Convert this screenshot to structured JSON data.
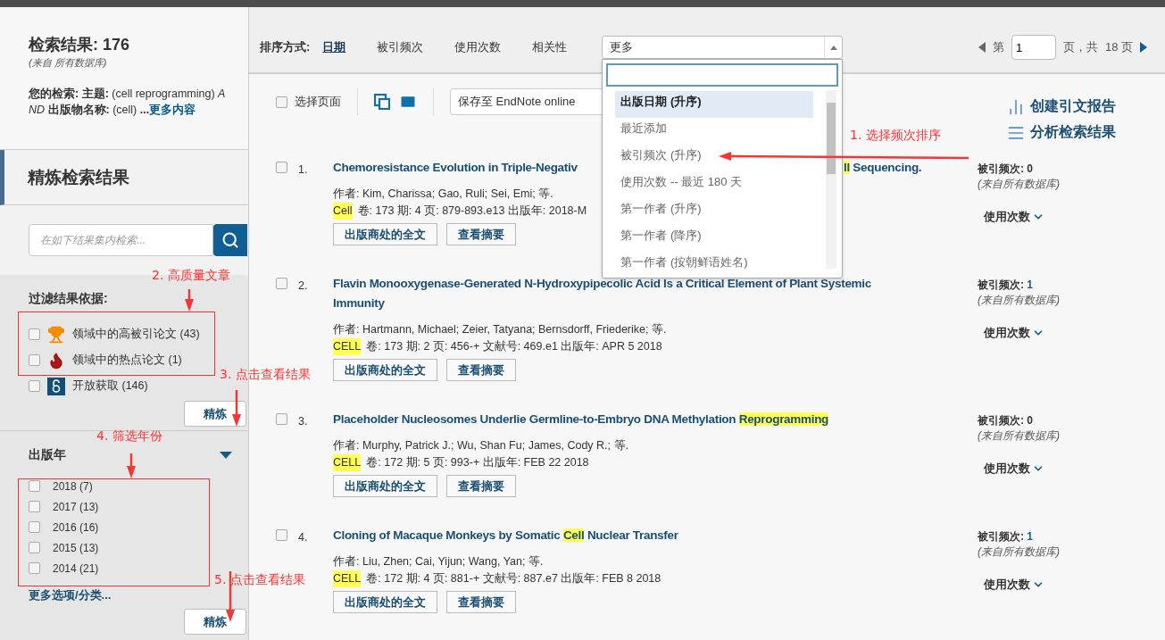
{
  "sidebar": {
    "results_title": "检索结果: 176",
    "results_source": "(来自 所有数据库)",
    "query": "**您的检索: 主题:** (cell reprogramming) *AND* **出版物名称:** (cell) **...**",
    "query_more": "更多内容",
    "refine_title": "精炼检索结果",
    "search": {
      "placeholder": "在如下结果集内检索..."
    },
    "filter_title": "过滤结果依据:",
    "filters": [
      {
        "label": "领域中的高被引论文 (43)",
        "checked": false,
        "kind": "trophy"
      },
      {
        "label": "领域中的热点论文 (1)",
        "checked": false,
        "kind": "hot"
      },
      {
        "label": "开放获取 (146)",
        "checked": false,
        "kind": "open"
      }
    ],
    "refine_button": "精炼",
    "year_title": "出版年",
    "year_expanded": true,
    "years": [
      {
        "label": "2018 (7)",
        "checked": false
      },
      {
        "label": "2017 (13)",
        "checked": false
      },
      {
        "label": "2016 (16)",
        "checked": false
      },
      {
        "label": "2015 (13)",
        "checked": false
      },
      {
        "label": "2014 (21)",
        "checked": false
      }
    ],
    "more_options": "更多选项/分类...",
    "refine_button_2": "精炼"
  },
  "sort_bar": {
    "label": "排序方式:",
    "options": [
      {
        "label": "日期",
        "selected": true
      },
      {
        "label": "被引频次",
        "selected": false
      },
      {
        "label": "使用次数",
        "selected": false
      },
      {
        "label": "相关性",
        "selected": false
      }
    ],
    "more_select": {
      "value": "更多",
      "expanded": true,
      "options": [
        {
          "label": "出版日期 (升序)",
          "selected": true
        },
        {
          "label": "最近添加",
          "selected": false
        },
        {
          "label": "被引频次 (升序)",
          "selected": false
        },
        {
          "label": "使用次数 -- 最近 180 天",
          "selected": false
        },
        {
          "label": "第一作者 (升序)",
          "selected": false
        },
        {
          "label": "第一作者 (降序)",
          "selected": false
        },
        {
          "label": "第一作者 (按朝鲜语姓名)",
          "selected": false
        }
      ]
    }
  },
  "pagination": {
    "prefix": "第",
    "page": "1",
    "middle": "页，共",
    "total": "18 页"
  },
  "toolbar": {
    "select_page": {
      "label": "选择页面",
      "checked": false
    },
    "save_select": "保存至 EndNote online",
    "links": [
      {
        "label": "创建引文报告",
        "kind": "chart"
      },
      {
        "label": "分析检索结果",
        "kind": "list"
      }
    ]
  },
  "records": [
    {
      "number": "1.",
      "checked": false,
      "title": [
        [
          {
            "text": "Chemoresistance Evolution in Triple-Negativ",
            "highlight": false
          }
        ],
        [
          {
            "text": "ll",
            "highlight": true
          },
          {
            "text": " Sequencing.",
            "highlight": false
          }
        ]
      ],
      "authors": "作者: Kim, Charissa; Gao, Ruli; Sei, Emi; 等.",
      "journal": "Cell",
      "meta": "卷: 173  期: 4  页: 879-893.e13  出版年: 2018-M",
      "buttons": [
        "出版商处的全文",
        "查看摘要"
      ],
      "citations_label": "被引频次:",
      "citations": "0",
      "cited_link": false,
      "citations_source": "(来自所有数据库)",
      "usage": "使用次数"
    },
    {
      "number": "2.",
      "checked": false,
      "title": [
        [
          {
            "text": "Flavin Monooxygenase-Generated N-Hydroxypipecolic Acid Is a Critical Element of Plant Systemic Immunity",
            "highlight": false
          }
        ]
      ],
      "authors": "作者: Hartmann, Michael; Zeier, Tatyana; Bernsdorff, Friederike; 等.",
      "journal": "CELL",
      "meta": "卷: 173  期: 2  页: 456-+  文献号: 469.e1  出版年: APR 5 2018",
      "buttons": [
        "出版商处的全文",
        "查看摘要"
      ],
      "citations_label": "被引频次:",
      "citations": "1",
      "cited_link": true,
      "citations_source": "(来自所有数据库)",
      "usage": "使用次数"
    },
    {
      "number": "3.",
      "checked": false,
      "title": [
        [
          {
            "text": "Placeholder Nucleosomes Underlie Germline-to-Embryo DNA Methylation ",
            "highlight": false
          },
          {
            "text": "Reprogramming",
            "highlight": true
          }
        ]
      ],
      "authors": "作者: Murphy, Patrick J.; Wu, Shan Fu; James, Cody R.; 等.",
      "journal": "CELL",
      "meta": "卷: 172  期: 5  页: 993-+  出版年: FEB 22 2018",
      "buttons": [
        "出版商处的全文",
        "查看摘要"
      ],
      "citations_label": "被引频次:",
      "citations": "0",
      "cited_link": false,
      "citations_source": "(来自所有数据库)",
      "usage": "使用次数"
    },
    {
      "number": "4.",
      "checked": false,
      "title": [
        [
          {
            "text": "Cloning of Macaque Monkeys by Somatic ",
            "highlight": false
          },
          {
            "text": "Cell",
            "highlight": true
          },
          {
            "text": " Nuclear Transfer",
            "highlight": false
          }
        ]
      ],
      "authors": "作者: Liu, Zhen; Cai, Yijun; Wang, Yan; 等.",
      "journal": "CELL",
      "meta": "卷: 172  期: 4  页: 881-+  文献号: 887.e7  出版年: FEB 8 2018",
      "buttons": [
        "出版商处的全文",
        "查看摘要"
      ],
      "citations_label": "被引频次:",
      "citations": "1",
      "cited_link": true,
      "citations_source": "(来自所有数据库)",
      "usage": "使用次数"
    }
  ],
  "annotations": [
    {
      "text": "1.  选择频次排序"
    },
    {
      "text": "2.  高质量文章"
    },
    {
      "text": "3.  点击查看结果"
    },
    {
      "text": "4.  筛选年份"
    },
    {
      "text": "5.  点击查看结果"
    }
  ]
}
